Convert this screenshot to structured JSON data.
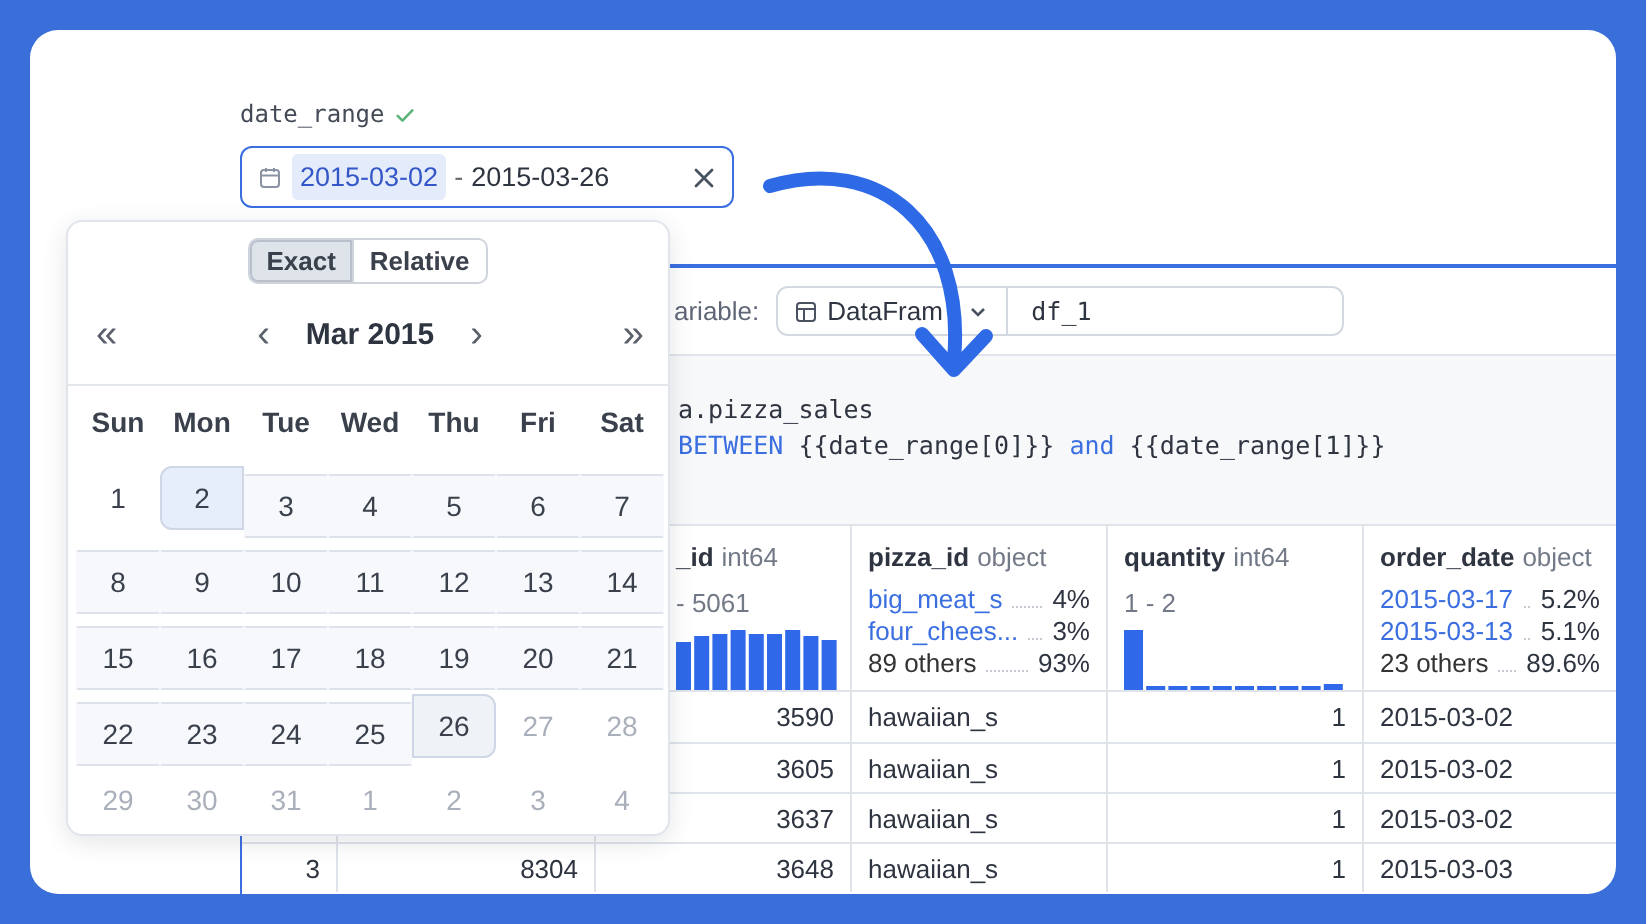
{
  "field": {
    "label": "date_range",
    "valid": true,
    "start": "2015-03-02",
    "separator": "-",
    "end": "2015-03-26"
  },
  "popover": {
    "modes": [
      {
        "label": "Exact",
        "selected": true
      },
      {
        "label": "Relative",
        "selected": false
      }
    ],
    "nav": {
      "prev_year": "«",
      "prev_month": "‹",
      "title": "Mar 2015",
      "next_month": "›",
      "next_year": "»"
    },
    "weekdays": [
      "Sun",
      "Mon",
      "Tue",
      "Wed",
      "Thu",
      "Fri",
      "Sat"
    ],
    "weeks": [
      [
        {
          "day": "1",
          "kind": "normal"
        },
        {
          "day": "2",
          "kind": "start"
        },
        {
          "day": "3",
          "kind": "range"
        },
        {
          "day": "4",
          "kind": "range"
        },
        {
          "day": "5",
          "kind": "range"
        },
        {
          "day": "6",
          "kind": "range"
        },
        {
          "day": "7",
          "kind": "range"
        }
      ],
      [
        {
          "day": "8",
          "kind": "range"
        },
        {
          "day": "9",
          "kind": "range"
        },
        {
          "day": "10",
          "kind": "range"
        },
        {
          "day": "11",
          "kind": "range"
        },
        {
          "day": "12",
          "kind": "range"
        },
        {
          "day": "13",
          "kind": "range"
        },
        {
          "day": "14",
          "kind": "range"
        }
      ],
      [
        {
          "day": "15",
          "kind": "range"
        },
        {
          "day": "16",
          "kind": "range"
        },
        {
          "day": "17",
          "kind": "range"
        },
        {
          "day": "18",
          "kind": "range"
        },
        {
          "day": "19",
          "kind": "range"
        },
        {
          "day": "20",
          "kind": "range"
        },
        {
          "day": "21",
          "kind": "range"
        }
      ],
      [
        {
          "day": "22",
          "kind": "range"
        },
        {
          "day": "23",
          "kind": "range"
        },
        {
          "day": "24",
          "kind": "range"
        },
        {
          "day": "25",
          "kind": "range"
        },
        {
          "day": "26",
          "kind": "end"
        },
        {
          "day": "27",
          "kind": "outside"
        },
        {
          "day": "28",
          "kind": "outside"
        }
      ],
      [
        {
          "day": "29",
          "kind": "outside"
        },
        {
          "day": "30",
          "kind": "outside"
        },
        {
          "day": "31",
          "kind": "outside"
        },
        {
          "day": "1",
          "kind": "outside"
        },
        {
          "day": "2",
          "kind": "outside"
        },
        {
          "day": "3",
          "kind": "outside"
        },
        {
          "day": "4",
          "kind": "outside"
        }
      ]
    ]
  },
  "cell": {
    "variable_label": "ariable:",
    "type_select": "DataFram",
    "name": "df_1",
    "code": [
      [
        {
          "text": "a.pizza_sales",
          "kind": "plain"
        }
      ],
      [
        {
          "text": "BETWEEN",
          "kind": "keyword"
        },
        {
          "text": " {{date_range[0]}} ",
          "kind": "plain"
        },
        {
          "text": "and",
          "kind": "keyword"
        },
        {
          "text": " {{date_range[1]}}",
          "kind": "plain"
        }
      ]
    ],
    "table": {
      "columns": [
        {
          "name": "_id",
          "dtype": "int64",
          "summary": {
            "kind": "histogram",
            "range": "- 5061"
          }
        },
        {
          "name": "pizza_id",
          "dtype": "object",
          "summary": {
            "kind": "top_values",
            "items": [
              {
                "label": "big_meat_s",
                "share": "4%",
                "kind": "top"
              },
              {
                "label": "four_chees...",
                "share": "3%",
                "kind": "top"
              },
              {
                "label": "89 others",
                "share": "93%",
                "kind": "others"
              }
            ]
          }
        },
        {
          "name": "quantity",
          "dtype": "int64",
          "summary": {
            "kind": "histogram",
            "range": "1 - 2"
          }
        },
        {
          "name": "order_date",
          "dtype": "object",
          "summary": {
            "kind": "top_values",
            "items": [
              {
                "label": "2015-03-17",
                "share": "5.2%",
                "kind": "top"
              },
              {
                "label": "2015-03-13",
                "share": "5.1%",
                "kind": "top"
              },
              {
                "label": "23 others",
                "share": "89.6%",
                "kind": "others"
              }
            ]
          }
        }
      ],
      "rows": [
        {
          "values": [
            "3590",
            "hawaiian_s",
            "1",
            "2015-03-02"
          ]
        },
        {
          "values": [
            "3605",
            "hawaiian_s",
            "1",
            "2015-03-02"
          ]
        },
        {
          "values": [
            "3637",
            "hawaiian_s",
            "1",
            "2015-03-02"
          ]
        },
        {
          "row_number": "3",
          "column_2": "8304",
          "values": [
            "3648",
            "hawaiian_s",
            "1",
            "2015-03-03"
          ]
        }
      ]
    }
  }
}
